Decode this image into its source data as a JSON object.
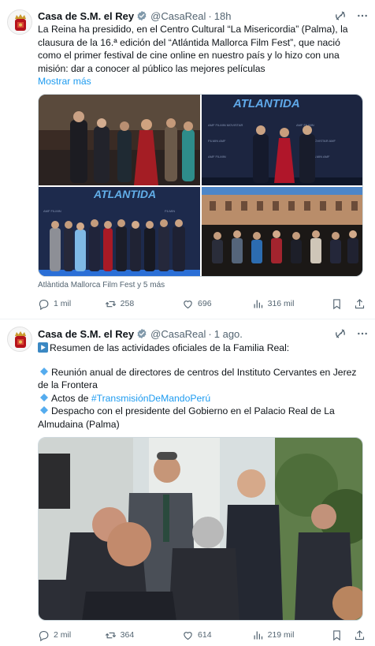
{
  "tweets": [
    {
      "author_name": "Casa de S.M. el Rey",
      "handle": "@CasaReal",
      "separator": "·",
      "time": "18h",
      "text": "La Reina ha presidido, en el Centro Cultural “La Misericordia” (Palma), la clausura de la 16.ª edición del “Atlántida Mallorca Film Fest”, que nació como el primer festival de cine online en nuestro país y lo hizo con una misión: dar a conocer al público las mejores películas",
      "show_more": "Mostrar más",
      "media_caption": "Atlàntida Mallorca Film Fest y 5 más",
      "replies": "1 mil",
      "retweets": "258",
      "likes": "696",
      "views": "316 mil"
    },
    {
      "author_name": "Casa de S.M. el Rey",
      "handle": "@CasaReal",
      "separator": "·",
      "time": "1 ago.",
      "line1": "Resumen de las actividades oficiales de la Familia Real:",
      "bullet1": "Reunión anual de directores de centros del Instituto Cervantes en Jerez de la Frontera",
      "bullet2_prefix": "Actos de ",
      "bullet2_hashtag": "#TransmisiónDeMandoPerú",
      "bullet3": "Despacho con el presidente del Gobierno en el Palacio Real de La Almudaina (Palma)",
      "replies": "2 mil",
      "retweets": "364",
      "likes": "614",
      "views": "219 mil"
    }
  ],
  "icons": {
    "verified": "verified-badge-icon",
    "grok": "grok-icon",
    "more": "more-options-icon",
    "reply": "reply-icon",
    "retweet": "retweet-icon",
    "like": "like-icon",
    "views": "views-icon",
    "bookmark": "bookmark-icon",
    "share": "share-icon",
    "play": "play-icon",
    "diamond": "small-blue-diamond-icon"
  },
  "colors": {
    "accent": "#1d9bf0",
    "text": "#0f1419",
    "secondary": "#536471",
    "verified_gold": "#b8962e"
  }
}
